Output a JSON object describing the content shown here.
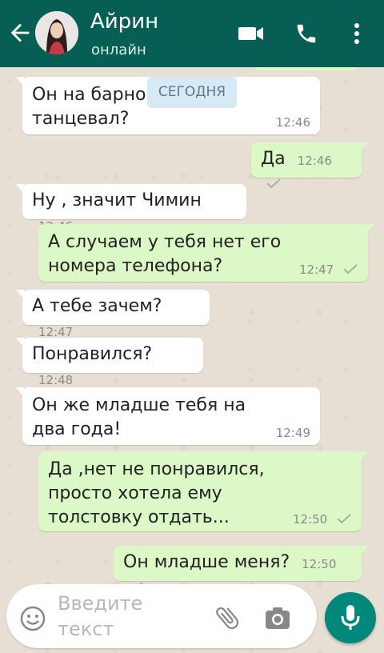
{
  "header": {
    "contact_name": "Айрин",
    "status": "онлайн",
    "background": "#075e54",
    "icons": [
      "back-arrow-icon",
      "video-call-icon",
      "phone-icon",
      "more-vert-icon"
    ]
  },
  "date_chip": "СЕГОДНЯ",
  "messages": [
    {
      "direction": "in",
      "text_lines": [
        "Он на барно",
        "танцевал?"
      ],
      "time": "12:46"
    },
    {
      "direction": "out",
      "text": "Да",
      "time": "12:46",
      "ticks": "single"
    },
    {
      "direction": "in",
      "text": "Ну , значит Чимин",
      "time": "12:46"
    },
    {
      "direction": "out",
      "text_lines": [
        "А случаем у тебя нет его",
        "номера телефона?"
      ],
      "time": "12:47",
      "ticks": "single"
    },
    {
      "direction": "in",
      "text": "А тебе зачем?",
      "time": "12:47"
    },
    {
      "direction": "in",
      "text": "Понравился?",
      "time": "12:48"
    },
    {
      "direction": "in",
      "text_lines": [
        "Он же младше тебя на",
        "два года!"
      ],
      "time": "12:49"
    },
    {
      "direction": "out",
      "text_lines": [
        "Да ,нет не понравился,",
        "просто хотела ему",
        "толстовку отдать..."
      ],
      "time": "12:50",
      "ticks": "single"
    },
    {
      "direction": "out",
      "text": "Он младше меня?",
      "time": "12:50",
      "ticks": "single"
    }
  ],
  "composer": {
    "placeholder": "Введите текст",
    "icons": [
      "emoji-icon",
      "attach-icon",
      "camera-icon",
      "mic-icon"
    ]
  },
  "colors": {
    "chat_bg": "#e7dfd4",
    "bubble_out": "#dcf8c6",
    "bubble_in": "#ffffff",
    "accent": "#00897b"
  }
}
